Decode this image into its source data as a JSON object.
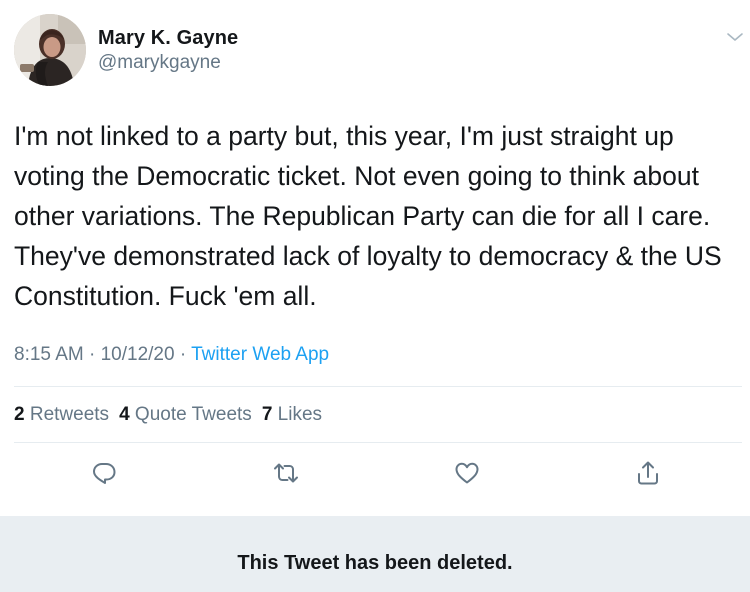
{
  "author": {
    "display_name": "Mary K. Gayne",
    "handle": "@marykgayne"
  },
  "tweet": {
    "lines": [
      "I'm not linked to a party but, this year, I'm just straight up",
      "voting the Democratic ticket. Not even going to think about",
      "other variations. The Republican Party can die for all I care.",
      "They've demonstrated lack of loyalty to democracy & the US",
      "Constitution. Fuck 'em all."
    ],
    "time": "8:15 AM",
    "date": "10/12/20",
    "separator": "·",
    "source": "Twitter Web App"
  },
  "stats": {
    "retweets_count": "2",
    "retweets_label": "Retweets",
    "quote_count": "4",
    "quote_label": "Quote Tweets",
    "likes_count": "7",
    "likes_label": "Likes"
  },
  "icons": {
    "menu": "chevron-down-icon",
    "reply": "reply-icon",
    "retweet": "retweet-icon",
    "like": "heart-icon",
    "share": "share-icon"
  },
  "colors": {
    "accent": "#1da1f2",
    "icon": "#657786",
    "banner_bg": "#e9eef2"
  },
  "deleted_notice": "This Tweet has been deleted."
}
